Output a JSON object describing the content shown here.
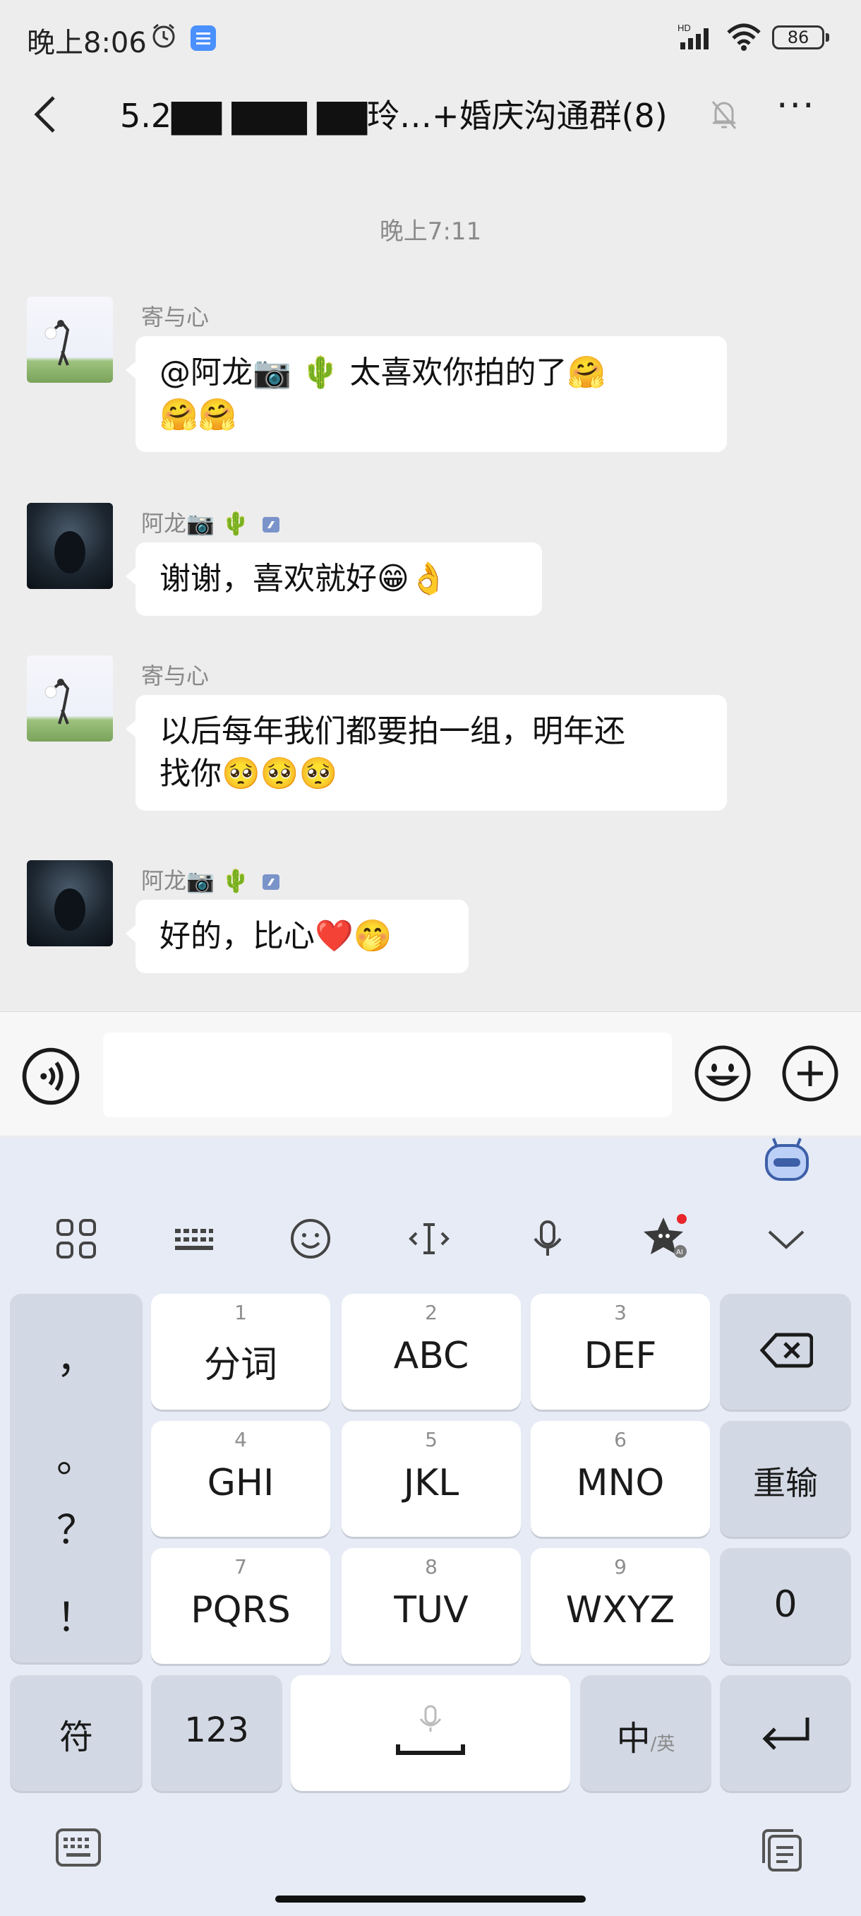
{
  "status_bar": {
    "time": "晚上8:06",
    "battery": "86",
    "signal_label": "HD"
  },
  "header": {
    "title": "5.2▇▇ ▇▇▇ ▇▇玲…+婚庆沟通群(8)",
    "icons": [
      "back-icon",
      "mute-bell-icon",
      "more-icon"
    ]
  },
  "chat": {
    "timestamp": "晚上7:11",
    "messages": [
      {
        "sender": "寄与心",
        "text": "@阿龙📷 🌵 太喜欢你拍的了🤗 🤗🤗",
        "line1": "@阿龙📷 🌵 太喜欢你拍的了🤗",
        "line2": "🤗🤗",
        "avatar": "light"
      },
      {
        "sender": "阿龙📷 🌵",
        "text": "谢谢，喜欢就好😁👌",
        "line1": "谢谢，喜欢就好😁👌",
        "avatar": "dark"
      },
      {
        "sender": "寄与心",
        "text": "以后每年我们都要拍一组，明年还找你🥺🥺🥺",
        "line1": "以后每年我们都要拍一组，明年还",
        "line2": "找你🥺🥺🥺",
        "avatar": "light"
      },
      {
        "sender": "阿龙📷 🌵",
        "text": "好的，比心❤️🤭",
        "line1": "好的，比心❤️🤭",
        "avatar": "dark"
      }
    ]
  },
  "input": {
    "value": "",
    "placeholder": ""
  },
  "keyboard": {
    "toolbar": [
      "apps-icon",
      "keyboard-icon",
      "emoji-icon",
      "cursor-icon",
      "mic-icon",
      "star-ai-icon",
      "collapse-icon"
    ],
    "keys_row1": [
      {
        "num": "1",
        "label": "分词"
      },
      {
        "num": "2",
        "label": "ABC"
      },
      {
        "num": "3",
        "label": "DEF"
      }
    ],
    "keys_row2": [
      {
        "num": "4",
        "label": "GHI"
      },
      {
        "num": "5",
        "label": "JKL"
      },
      {
        "num": "6",
        "label": "MNO"
      }
    ],
    "keys_row3": [
      {
        "num": "7",
        "label": "PQRS"
      },
      {
        "num": "8",
        "label": "TUV"
      },
      {
        "num": "9",
        "label": "WXYZ"
      }
    ],
    "punctuation": [
      "，",
      "。",
      "？",
      "！"
    ],
    "reinput": "重输",
    "zero": "0",
    "symbol": "符",
    "numbers": "123",
    "lang_main": "中",
    "lang_sub": "/英"
  },
  "colors": {
    "background": "#ededed",
    "bubble": "#ffffff",
    "keyboard_bg": "#e6ebf5",
    "key": "#ffffff",
    "key_function": "#d3d9e4"
  }
}
